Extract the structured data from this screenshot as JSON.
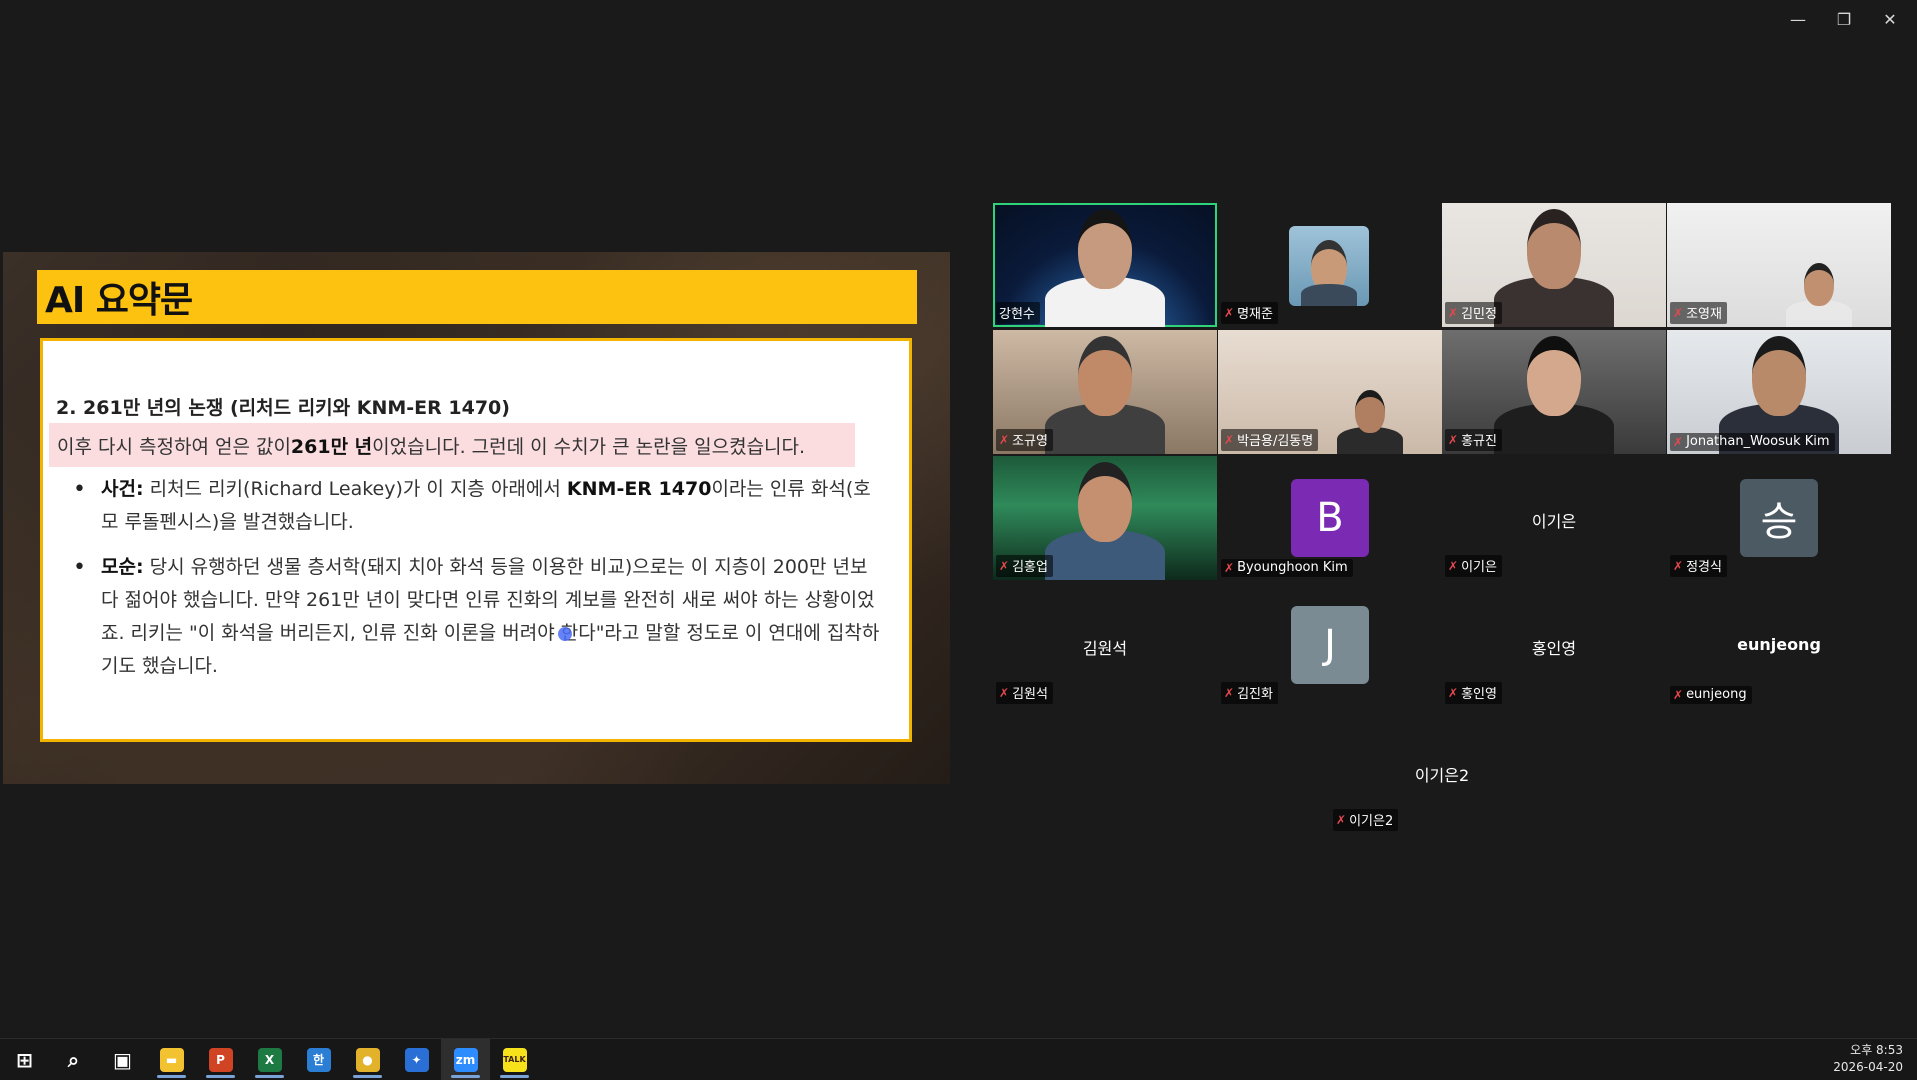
{
  "window": {
    "controls": {
      "minimize": "—",
      "restore": "❐",
      "close": "✕"
    }
  },
  "slide": {
    "title": "AI 요약문",
    "section_title": "2. 261만 년의 논쟁 (리처드 리키와 KNM-ER 1470)",
    "highlight": {
      "pre": "이후 다시 측정하여 얻은 값이 ",
      "bold": "261만 년",
      "post": "이었습니다. 그런데 이 수치가 큰 논란을 일으켰습니다."
    },
    "bullets": [
      {
        "label": "사건:",
        "text_pre": " 리처드 리키(Richard Leakey)가 이 지층 아래에서 ",
        "text_bold": "KNM-ER 1470",
        "text_post": "이라는 인류 화석(호모 루돌펜시스)을 발견했습니다."
      },
      {
        "label": "모순:",
        "text": " 당시 유행하던 생물 층서학(돼지 치아 화석 등을 이용한 비교)으로는 이 지층이 200만 년보다 젊어야 했습니다. 만약 261만 년이 맞다면 인류 진화의 계보를 완전히 새로 써야 하는 상황이었죠. 리키는 \"이 화석을 버리든지, 인류 진화 이론을 버려야 한다\"라고 말할 정도로 이 연대에 집착하기도 했습니다."
      }
    ]
  },
  "participants": [
    {
      "name": "강현수",
      "muted": false,
      "active": true,
      "kind": "video"
    },
    {
      "name": "명재준",
      "muted": true,
      "kind": "photo"
    },
    {
      "name": "김민정",
      "muted": true,
      "kind": "video"
    },
    {
      "name": "조영재",
      "muted": true,
      "kind": "video"
    },
    {
      "name": "조규영",
      "muted": true,
      "kind": "video"
    },
    {
      "name": "박금용/김동명",
      "muted": true,
      "kind": "video"
    },
    {
      "name": "홍규진",
      "muted": true,
      "kind": "video"
    },
    {
      "name": "Jonathan_Woosuk Kim",
      "muted": true,
      "kind": "video"
    },
    {
      "name": "김홍업",
      "muted": true,
      "kind": "video"
    },
    {
      "name": "Byounghoon Kim",
      "muted": true,
      "kind": "avatar",
      "letter": "B",
      "color": "#7b2bb3"
    },
    {
      "name": "이기은",
      "muted": true,
      "kind": "text",
      "display": "이기은"
    },
    {
      "name": "정경식",
      "muted": true,
      "kind": "avatar",
      "letter": "승",
      "color": "#4c5a63"
    },
    {
      "name": "김원석",
      "muted": true,
      "kind": "text",
      "display": "김원석"
    },
    {
      "name": "김진화",
      "muted": true,
      "kind": "avatar",
      "letter": "J",
      "color": "#7b8b94"
    },
    {
      "name": "홍인영",
      "muted": true,
      "kind": "text",
      "display": "홍인영"
    },
    {
      "name": "eunjeong",
      "muted": true,
      "kind": "text",
      "display": "eunjeong"
    },
    {
      "name": "이기은2",
      "muted": true,
      "kind": "text",
      "display": "이기은2"
    }
  ],
  "taskbar": {
    "apps": [
      {
        "name": "start",
        "glyph": "⊞",
        "color": "#ffffff"
      },
      {
        "name": "search",
        "glyph": "⌕",
        "color": "#ffffff"
      },
      {
        "name": "task-view",
        "glyph": "▣",
        "color": "#ffffff"
      },
      {
        "name": "file-explorer",
        "glyph": "▬",
        "color": "#f2c230"
      },
      {
        "name": "powerpoint",
        "glyph": "P",
        "color": "#d04423"
      },
      {
        "name": "excel",
        "glyph": "X",
        "color": "#1d7a43"
      },
      {
        "name": "hancom",
        "glyph": "한",
        "color": "#2a7fd4"
      },
      {
        "name": "chrome",
        "glyph": "●",
        "color": "#e2b22b"
      },
      {
        "name": "app-blue",
        "glyph": "✦",
        "color": "#2a6fd6"
      },
      {
        "name": "zoom",
        "glyph": "zm",
        "color": "#2d8cff"
      },
      {
        "name": "kakaotalk",
        "glyph": "TALK",
        "color": "#f7e11b"
      }
    ],
    "clock": {
      "time": "오후 8:53",
      "date": "2026-04-20"
    }
  }
}
